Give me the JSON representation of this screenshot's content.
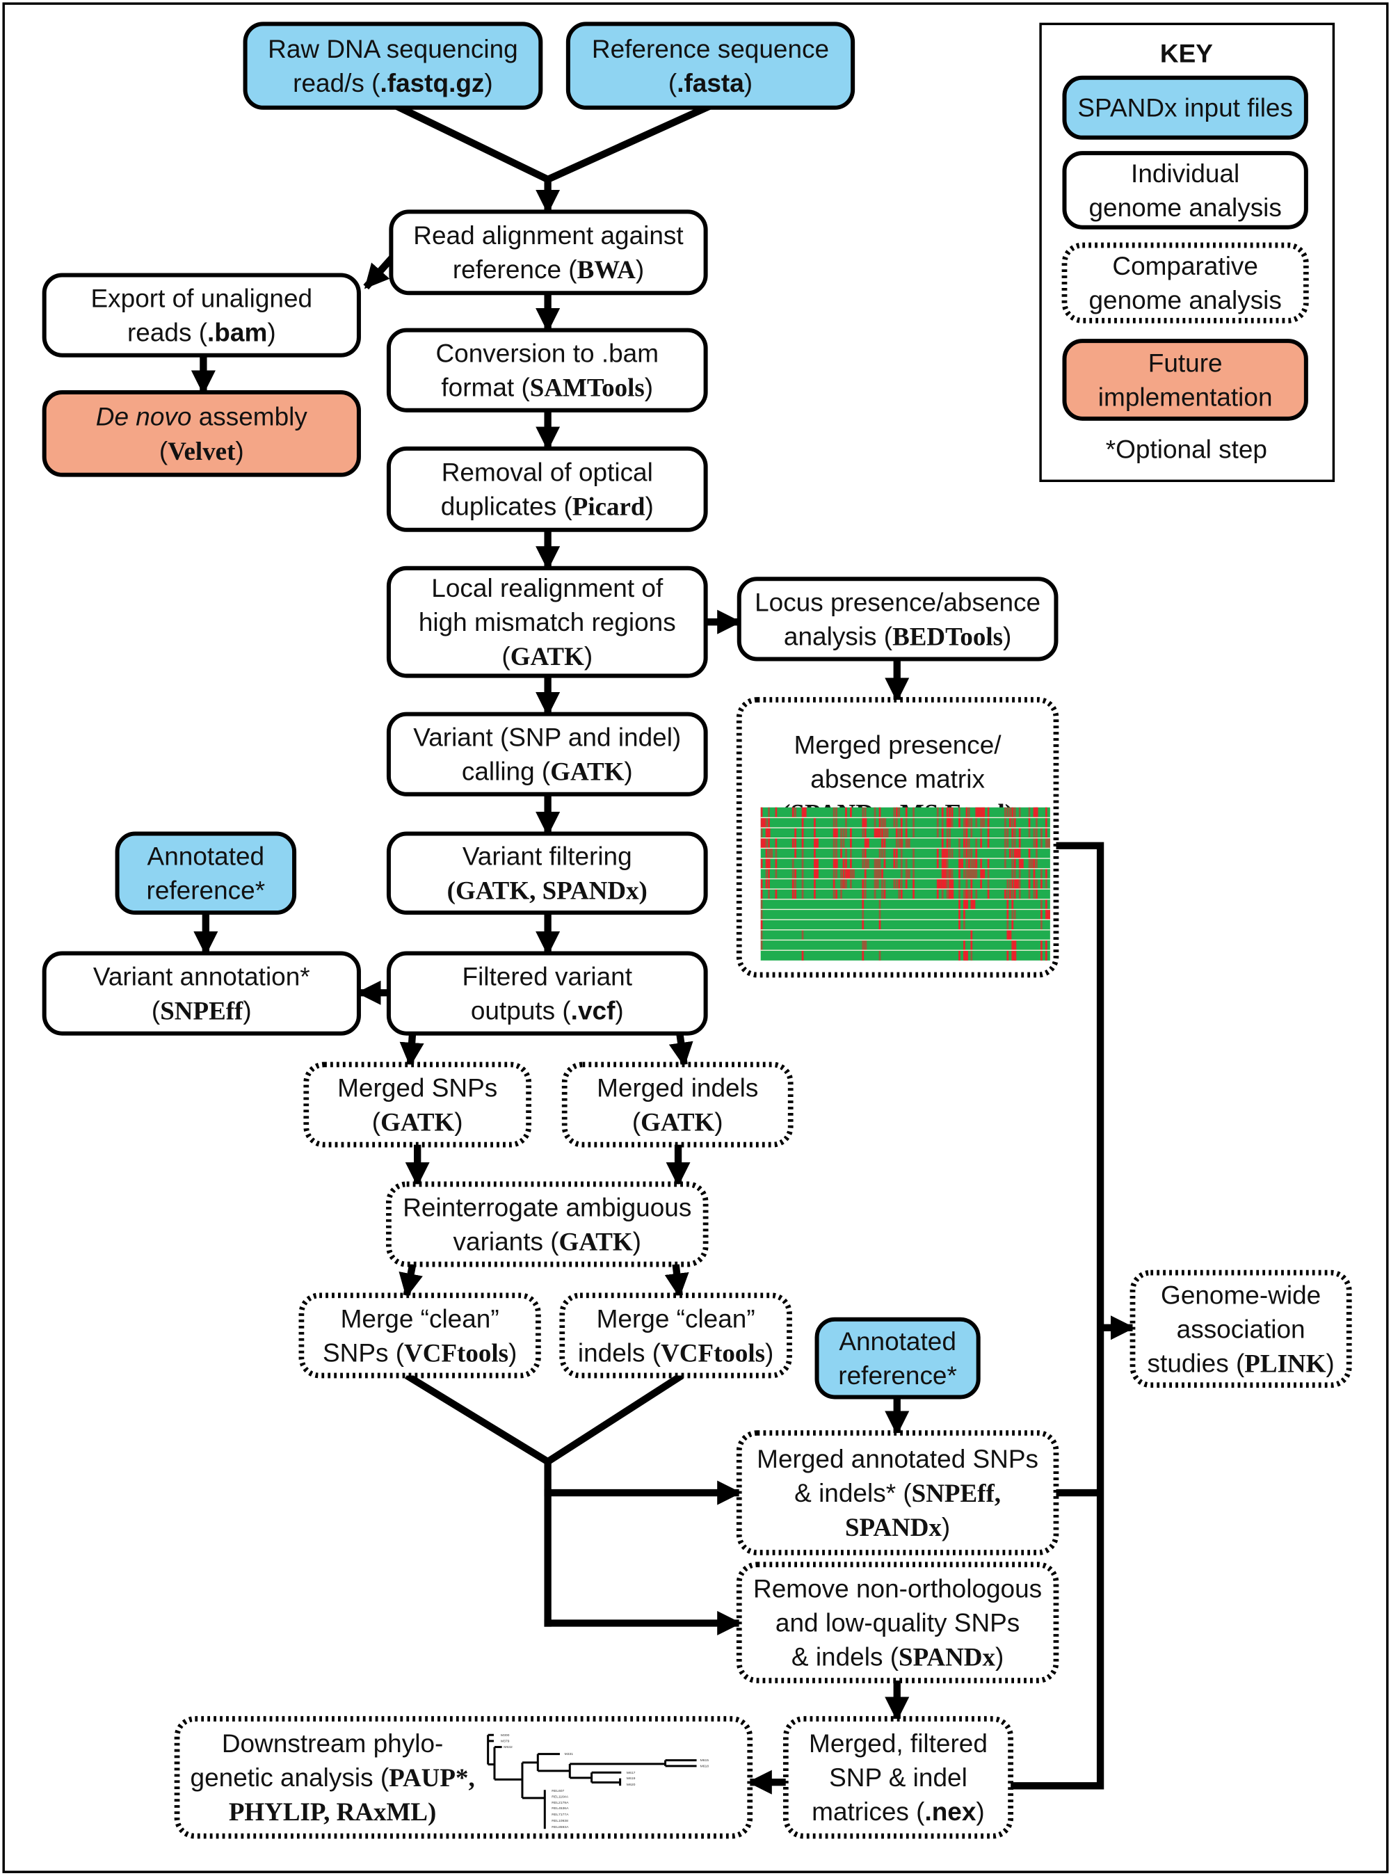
{
  "colors": {
    "input": "#8fd4f2",
    "individual": "#ffffff",
    "comparative": "#ffffff",
    "future": "#f4a687",
    "heat_present": "#1fad4f",
    "heat_absent": "#e8232b"
  },
  "key": {
    "title": "KEY",
    "items": [
      {
        "style": "input",
        "lines": [
          "SPANDx input files"
        ]
      },
      {
        "style": "individual",
        "lines": [
          "Individual",
          "genome analysis"
        ]
      },
      {
        "style": "comparative",
        "lines": [
          "Comparative",
          "genome analysis"
        ]
      },
      {
        "style": "future",
        "lines": [
          "Future",
          "implementation"
        ]
      }
    ],
    "note": "*Optional step"
  },
  "nodes": [
    {
      "id": "raw",
      "style": "input",
      "lines": [
        [
          {
            "t": "Raw DNA sequencing"
          }
        ],
        [
          {
            "t": "read/s ("
          },
          {
            "t": ".fastq.gz",
            "f": "s"
          },
          {
            "t": ")"
          }
        ]
      ]
    },
    {
      "id": "ref",
      "style": "input",
      "lines": [
        [
          {
            "t": "Reference sequence"
          }
        ],
        [
          {
            "t": "("
          },
          {
            "t": ".fasta",
            "f": "s"
          },
          {
            "t": ")"
          }
        ]
      ]
    },
    {
      "id": "bwa",
      "style": "individual",
      "lines": [
        [
          {
            "t": "Read alignment against"
          }
        ],
        [
          {
            "t": "reference ("
          },
          {
            "t": "BWA",
            "f": "b"
          },
          {
            "t": ")"
          }
        ]
      ]
    },
    {
      "id": "unaligned",
      "style": "individual",
      "lines": [
        [
          {
            "t": "Export of unaligned"
          }
        ],
        [
          {
            "t": "reads ("
          },
          {
            "t": ".bam",
            "f": "s"
          },
          {
            "t": ")"
          }
        ]
      ]
    },
    {
      "id": "velvet",
      "style": "future",
      "lines": [
        [
          {
            "t": "De novo",
            "f": "i"
          },
          {
            "t": " assembly"
          }
        ],
        [
          {
            "t": "("
          },
          {
            "t": "Velvet",
            "f": "b"
          },
          {
            "t": ")"
          }
        ]
      ]
    },
    {
      "id": "samtools",
      "style": "individual",
      "lines": [
        [
          {
            "t": "Conversion to .bam"
          }
        ],
        [
          {
            "t": "format ("
          },
          {
            "t": "SAMTools",
            "f": "b"
          },
          {
            "t": ")"
          }
        ]
      ]
    },
    {
      "id": "picard",
      "style": "individual",
      "lines": [
        [
          {
            "t": "Removal of optical"
          }
        ],
        [
          {
            "t": "duplicates ("
          },
          {
            "t": "Picard",
            "f": "b"
          },
          {
            "t": ")"
          }
        ]
      ]
    },
    {
      "id": "realign",
      "style": "individual",
      "lines": [
        [
          {
            "t": "Local realignment of"
          }
        ],
        [
          {
            "t": "high mismatch regions"
          }
        ],
        [
          {
            "t": "("
          },
          {
            "t": "GATK",
            "f": "b"
          },
          {
            "t": ")"
          }
        ]
      ]
    },
    {
      "id": "bedtools",
      "style": "individual",
      "lines": [
        [
          {
            "t": "Locus presence/absence"
          }
        ],
        [
          {
            "t": "analysis ("
          },
          {
            "t": "BEDTools",
            "f": "b"
          },
          {
            "t": ")"
          }
        ]
      ]
    },
    {
      "id": "matrix",
      "style": "comparative",
      "lines": [
        [
          {
            "t": "Merged presence/"
          }
        ],
        [
          {
            "t": "absence matrix"
          }
        ],
        [
          {
            "t": "(SPANDx, MS Excel)",
            "f": "b"
          }
        ]
      ]
    },
    {
      "id": "calling",
      "style": "individual",
      "lines": [
        [
          {
            "t": "Variant (SNP and indel)"
          }
        ],
        [
          {
            "t": "calling ("
          },
          {
            "t": "GATK",
            "f": "b"
          },
          {
            "t": ")"
          }
        ]
      ]
    },
    {
      "id": "filtering",
      "style": "individual",
      "lines": [
        [
          {
            "t": "Variant filtering"
          }
        ],
        [
          {
            "t": "(GATK, SPANDx)",
            "f": "b"
          }
        ]
      ]
    },
    {
      "id": "annref1",
      "style": "input",
      "lines": [
        [
          {
            "t": "Annotated"
          }
        ],
        [
          {
            "t": "reference*"
          }
        ]
      ]
    },
    {
      "id": "annotation",
      "style": "individual",
      "lines": [
        [
          {
            "t": "Variant annotation*"
          }
        ],
        [
          {
            "t": "("
          },
          {
            "t": "SNPEff",
            "f": "b"
          },
          {
            "t": ")"
          }
        ]
      ]
    },
    {
      "id": "filtered",
      "style": "individual",
      "lines": [
        [
          {
            "t": "Filtered variant"
          }
        ],
        [
          {
            "t": "outputs ("
          },
          {
            "t": ".vcf",
            "f": "s"
          },
          {
            "t": ")"
          }
        ]
      ]
    },
    {
      "id": "msnps",
      "style": "comparative",
      "lines": [
        [
          {
            "t": "Merged SNPs"
          }
        ],
        [
          {
            "t": "("
          },
          {
            "t": "GATK",
            "f": "b"
          },
          {
            "t": ")"
          }
        ]
      ]
    },
    {
      "id": "mindels",
      "style": "comparative",
      "lines": [
        [
          {
            "t": "Merged indels"
          }
        ],
        [
          {
            "t": "("
          },
          {
            "t": "GATK",
            "f": "b"
          },
          {
            "t": ")"
          }
        ]
      ]
    },
    {
      "id": "reint",
      "style": "comparative",
      "lines": [
        [
          {
            "t": "Reinterrogate ambiguous"
          }
        ],
        [
          {
            "t": "variants ("
          },
          {
            "t": "GATK",
            "f": "b"
          },
          {
            "t": ")"
          }
        ]
      ]
    },
    {
      "id": "csnps",
      "style": "comparative",
      "lines": [
        [
          {
            "t": "Merge “clean”"
          }
        ],
        [
          {
            "t": "SNPs ("
          },
          {
            "t": "VCFtools",
            "f": "b"
          },
          {
            "t": ")"
          }
        ]
      ]
    },
    {
      "id": "cindels",
      "style": "comparative",
      "lines": [
        [
          {
            "t": "Merge “clean”"
          }
        ],
        [
          {
            "t": "indels ("
          },
          {
            "t": "VCFtools",
            "f": "b"
          },
          {
            "t": ")"
          }
        ]
      ]
    },
    {
      "id": "annref2",
      "style": "input",
      "lines": [
        [
          {
            "t": "Annotated"
          }
        ],
        [
          {
            "t": "reference*"
          }
        ]
      ]
    },
    {
      "id": "mannot",
      "style": "comparative",
      "lines": [
        [
          {
            "t": "Merged annotated  SNPs"
          }
        ],
        [
          {
            "t": "& indels* ("
          },
          {
            "t": "SNPEff,",
            "f": "b"
          }
        ],
        [
          {
            "t": "SPANDx",
            "f": "b"
          },
          {
            "t": ")"
          }
        ]
      ]
    },
    {
      "id": "remove",
      "style": "comparative",
      "lines": [
        [
          {
            "t": "Remove non-orthologous"
          }
        ],
        [
          {
            "t": "and low-quality SNPs"
          }
        ],
        [
          {
            "t": "& indels ("
          },
          {
            "t": "SPANDx",
            "f": "b"
          },
          {
            "t": ")"
          }
        ]
      ]
    },
    {
      "id": "mfilt",
      "style": "comparative",
      "lines": [
        [
          {
            "t": "Merged, filtered"
          }
        ],
        [
          {
            "t": "SNP & indel"
          }
        ],
        [
          {
            "t": "matrices ("
          },
          {
            "t": ".nex",
            "f": "s"
          },
          {
            "t": ")"
          }
        ]
      ]
    },
    {
      "id": "down",
      "style": "comparative",
      "lines": [
        [
          {
            "t": "Downstream phylo-"
          }
        ],
        [
          {
            "t": "genetic analysis ("
          },
          {
            "t": "PAUP*,",
            "f": "b"
          }
        ],
        [
          {
            "t": "PHYLIP, RAxML)",
            "f": "b"
          }
        ]
      ]
    },
    {
      "id": "gwas",
      "style": "comparative",
      "lines": [
        [
          {
            "t": "Genome-wide"
          }
        ],
        [
          {
            "t": "association"
          }
        ],
        [
          {
            "t": "studies ("
          },
          {
            "t": "PLINK",
            "f": "b"
          },
          {
            "t": ")"
          }
        ]
      ]
    }
  ],
  "tree_labels": [
    "M300",
    "M379",
    "M632",
    "M331",
    "M615",
    "M618",
    "M617",
    "M619",
    "M620",
    "REL607",
    "REL1164A",
    "REL2179A",
    "REL4536A",
    "REL7177A",
    "REL10938",
    "REL8593A"
  ]
}
